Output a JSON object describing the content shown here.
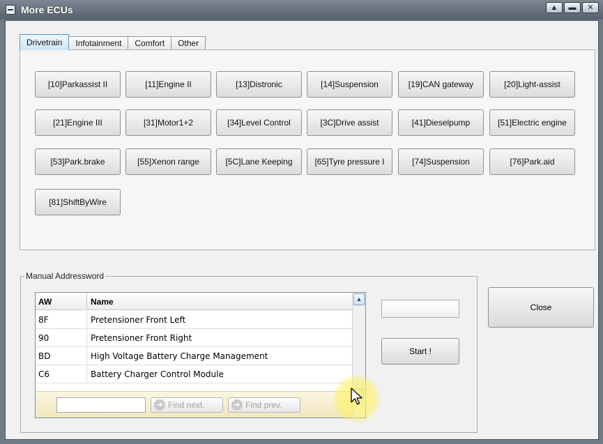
{
  "window": {
    "title": "More ECUs",
    "controls": {
      "minimize": "▲",
      "restore": "▬",
      "close": "✕"
    }
  },
  "tabs": [
    {
      "label": "Drivetrain",
      "active": true
    },
    {
      "label": "Infotainment",
      "active": false
    },
    {
      "label": "Comfort",
      "active": false
    },
    {
      "label": "Other",
      "active": false
    }
  ],
  "ecus": [
    "[10]Parkassist II",
    "[11]Engine II",
    "[13]Distronic",
    "[14]Suspension",
    "[19]CAN gateway",
    "[20]Light-assist",
    "[21]Engine III",
    "[31]Motor1+2",
    "[34]Level Control",
    "[3C]Drive assist",
    "[41]Dieselpump",
    "[51]Electric engine",
    "[53]Park.brake",
    "[55]Xenon range",
    "[5C]Lane Keeping",
    "[65]Tyre pressure I",
    "[74]Suspension",
    "[76]Park.aid",
    "[81]ShiftByWire"
  ],
  "manual": {
    "group_label": "Manual Addressword",
    "columns": {
      "aw": "AW",
      "name": "Name"
    },
    "rows": [
      {
        "aw": "8F",
        "name": "Pretensioner Front Left"
      },
      {
        "aw": "90",
        "name": "Pretensioner Front Right"
      },
      {
        "aw": "BD",
        "name": "High Voltage Battery Charge Management"
      },
      {
        "aw": "C6",
        "name": "Battery Charger Control Module"
      }
    ],
    "find_value": "",
    "find_next_label": "Find next.",
    "find_prev_label": "Find prev.",
    "address_value": "",
    "start_label": "Start !"
  },
  "close_label": "Close",
  "icons": {
    "sysmenu": "window-menu-icon",
    "scroll_up": "chevron-up-icon",
    "find": "search-arrow-icon",
    "cursor": "mouse-pointer-icon"
  },
  "colors": {
    "active_tab": "#cfe6f7",
    "footer_band": "#f1e6bd",
    "highlight": "#fff078"
  }
}
